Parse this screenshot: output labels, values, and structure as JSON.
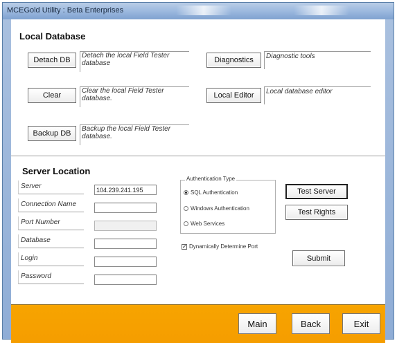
{
  "window": {
    "title": "MCEGold Utility : Beta Enterprises"
  },
  "local_database": {
    "title": "Local Database",
    "detach": {
      "label": "Detach DB",
      "description": "Detach the local Field Tester database"
    },
    "clear": {
      "label": "Clear",
      "description": "Clear the local Field Tester database."
    },
    "backup": {
      "label": "Backup DB",
      "description": "Backup the local Field Tester database."
    },
    "diagnostics": {
      "label": "Diagnostics",
      "description": "Diagnostic tools"
    },
    "local_editor": {
      "label": "Local Editor",
      "description": "Local database editor"
    }
  },
  "server_location": {
    "title": "Server Location",
    "fields": {
      "server": {
        "label": "Server",
        "value": "104.239.241.195"
      },
      "connection_name": {
        "label": "Connection Name",
        "value": ""
      },
      "port_number": {
        "label": "Port Number",
        "value": ""
      },
      "database": {
        "label": "Database",
        "value": ""
      },
      "login": {
        "label": "Login",
        "value": ""
      },
      "password": {
        "label": "Password",
        "value": ""
      }
    },
    "auth": {
      "legend": "Authentication Type",
      "options": [
        "SQL Authentication",
        "Windows Authentication",
        "Web Services"
      ],
      "selected": "SQL Authentication"
    },
    "dynamic_port": {
      "label": "Dynamically Determine Port",
      "checked": true,
      "mark": "✓"
    },
    "buttons": {
      "test_server": "Test Server",
      "test_rights": "Test Rights",
      "submit": "Submit"
    }
  },
  "footer": {
    "main": "Main",
    "back": "Back",
    "exit": "Exit"
  },
  "colors": {
    "footer_bar": "#f7a400",
    "title_bar": "#9fbbe0"
  }
}
